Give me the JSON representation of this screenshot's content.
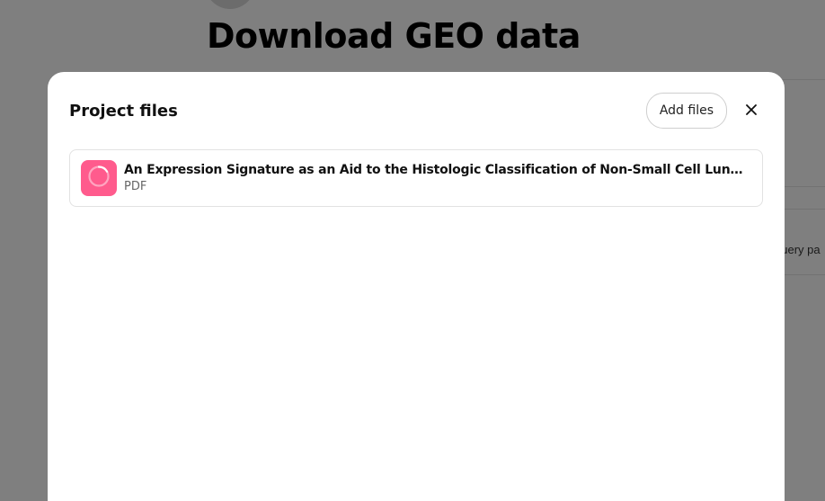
{
  "background": {
    "page_title": "Download GEO data",
    "query_text": "query pa"
  },
  "modal": {
    "title": "Project files",
    "add_files_label": "Add files",
    "close_icon": "close-icon",
    "files": [
      {
        "name": "An Expression Signature as an Aid to the Histologic Classification of Non-Small Cell Lung Cancer....",
        "type": "PDF",
        "icon": "pdf-loading-spinner-icon",
        "icon_color": "#ff5b8d"
      }
    ]
  },
  "colors": {
    "overlay": "rgba(0,0,0,0.5)",
    "file_icon_bg": "#ff5b8d"
  }
}
